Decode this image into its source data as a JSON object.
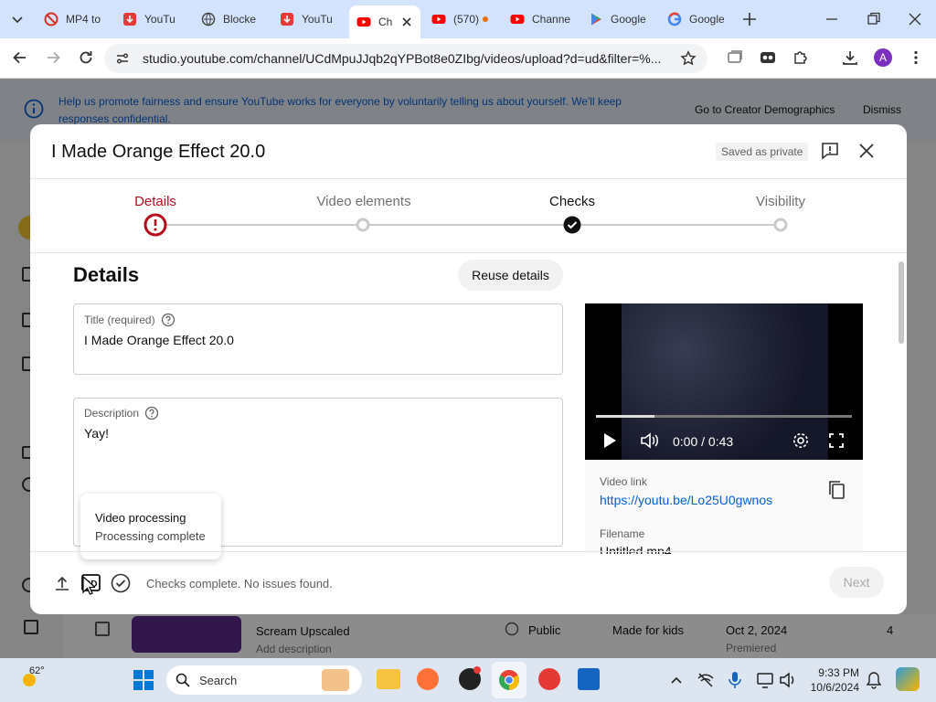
{
  "browser": {
    "tabs": [
      {
        "label": "MP4 to",
        "icon": "blocked-icon"
      },
      {
        "label": "YouTu",
        "icon": "download-icon"
      },
      {
        "label": "Blocke",
        "icon": "globe-icon"
      },
      {
        "label": "YouTu",
        "icon": "download-icon"
      },
      {
        "label": "Ch",
        "icon": "youtube-icon"
      },
      {
        "label": "(570)",
        "icon": "youtube-icon"
      },
      {
        "label": "Channe",
        "icon": "youtube-icon"
      },
      {
        "label": "Google",
        "icon": "play-store-icon"
      },
      {
        "label": "Google",
        "icon": "google-icon"
      }
    ],
    "url": "studio.youtube.com/channel/UCdMpuJJqb2qYPBot8e0ZIbg/videos/upload?d=ud&filter=%...",
    "profile_initial": "A"
  },
  "banner": {
    "text": "Help us promote fairness and ensure YouTube works for everyone by voluntarily telling us about yourself. We'll keep responses confidential.",
    "go_button": "Go to Creator Demographics",
    "dismiss_button": "Dismiss"
  },
  "dialog": {
    "title": "I Made Orange Effect 20.0",
    "saved_badge": "Saved as private",
    "steps": [
      {
        "label": "Details",
        "state": "error"
      },
      {
        "label": "Video elements",
        "state": "todo"
      },
      {
        "label": "Checks",
        "state": "done"
      },
      {
        "label": "Visibility",
        "state": "todo"
      }
    ],
    "section_title": "Details",
    "reuse_button": "Reuse details",
    "title_field": {
      "label": "Title (required)",
      "value": "I Made Orange Effect 20.0"
    },
    "description_field": {
      "label": "Description",
      "value": "Yay!"
    },
    "processing_toast": {
      "title": "Video processing",
      "subtitle": "Processing complete"
    },
    "player": {
      "time": "0:00 / 0:43",
      "progress": 0.23
    },
    "video_link_label": "Video link",
    "video_link": "https://youtu.be/Lo25U0gwnos",
    "filename_label": "Filename",
    "filename": "Untitled.mp4",
    "footer_status": "Checks complete. No issues found.",
    "next_button": "Next"
  },
  "background_row": {
    "title": "Scream Upscaled",
    "subtitle": "Add description",
    "visibility": "Public",
    "audience": "Made for kids",
    "date": "Oct 2, 2024",
    "date_sub": "Premiered",
    "views": "4"
  },
  "taskbar": {
    "weather": "62°",
    "search_placeholder": "Search",
    "time": "9:33 PM",
    "date": "10/6/2024"
  },
  "colors": {
    "accent": "#065fd4",
    "error": "#b80b1d",
    "youtube_red": "#ff0000"
  }
}
